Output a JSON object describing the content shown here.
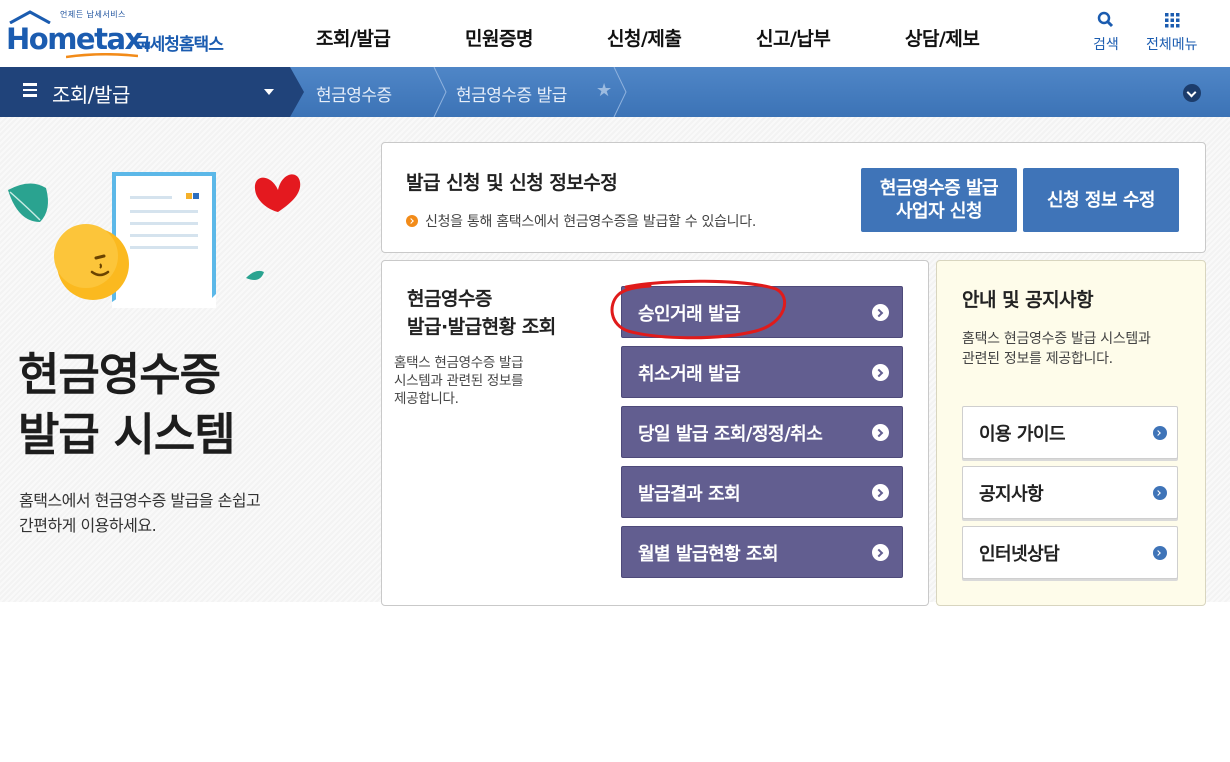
{
  "logo": {
    "tagline": "언제든 납세서비스",
    "word": "Hometax.",
    "korean": "국세청홈택스"
  },
  "gnb": [
    "조회/발급",
    "민원증명",
    "신청/제출",
    "신고/납부",
    "상담/제보"
  ],
  "util": {
    "search_label": "검색",
    "menu_label": "전체메뉴",
    "search_icon": "search-icon",
    "menu_icon": "grid-menu-icon"
  },
  "breadcrumb": {
    "home_label": "조회/발급",
    "crumbs": [
      "현금영수증",
      "현금영수증 발급"
    ]
  },
  "hero": {
    "title_lines": [
      "현금영수증",
      "발급 시스템"
    ],
    "desc_lines": [
      "홈택스에서 현금영수증 발급을 손쉽고",
      "간편하게 이용하세요."
    ]
  },
  "apply_section": {
    "title": "발급 신청 및 신청 정보수정",
    "desc": "신청을 통해 홈택스에서 현금영수증을 발급할 수 있습니다.",
    "apply_button": [
      "현금영수증 발급",
      "사업자 신청"
    ],
    "edit_button": "신청 정보 수정"
  },
  "inquiry_section": {
    "title_lines": [
      "현금영수증",
      "발급·발급현황 조회"
    ],
    "desc_lines": [
      "홈택스 현금영수증 발급",
      "시스템과 관련된 정보를",
      "제공합니다."
    ],
    "buttons": [
      "승인거래 발급",
      "취소거래 발급",
      "당일 발급 조회/정정/취소",
      "발급결과 조회",
      "월별 발급현황 조회"
    ]
  },
  "notice_section": {
    "title": "안내 및 공지사항",
    "desc_lines": [
      "홈택스 현금영수증 발급 시스템과",
      "관련된 정보를 제공합니다."
    ],
    "links": [
      "이용 가이드",
      "공지사항",
      "인터넷상담"
    ]
  },
  "colors": {
    "brand_blue": "#3f74b8",
    "nav_dark": "#20437a",
    "purple_button": "#625e90",
    "annotation_red": "#e01b1b",
    "notice_bg": "#fefcea"
  }
}
